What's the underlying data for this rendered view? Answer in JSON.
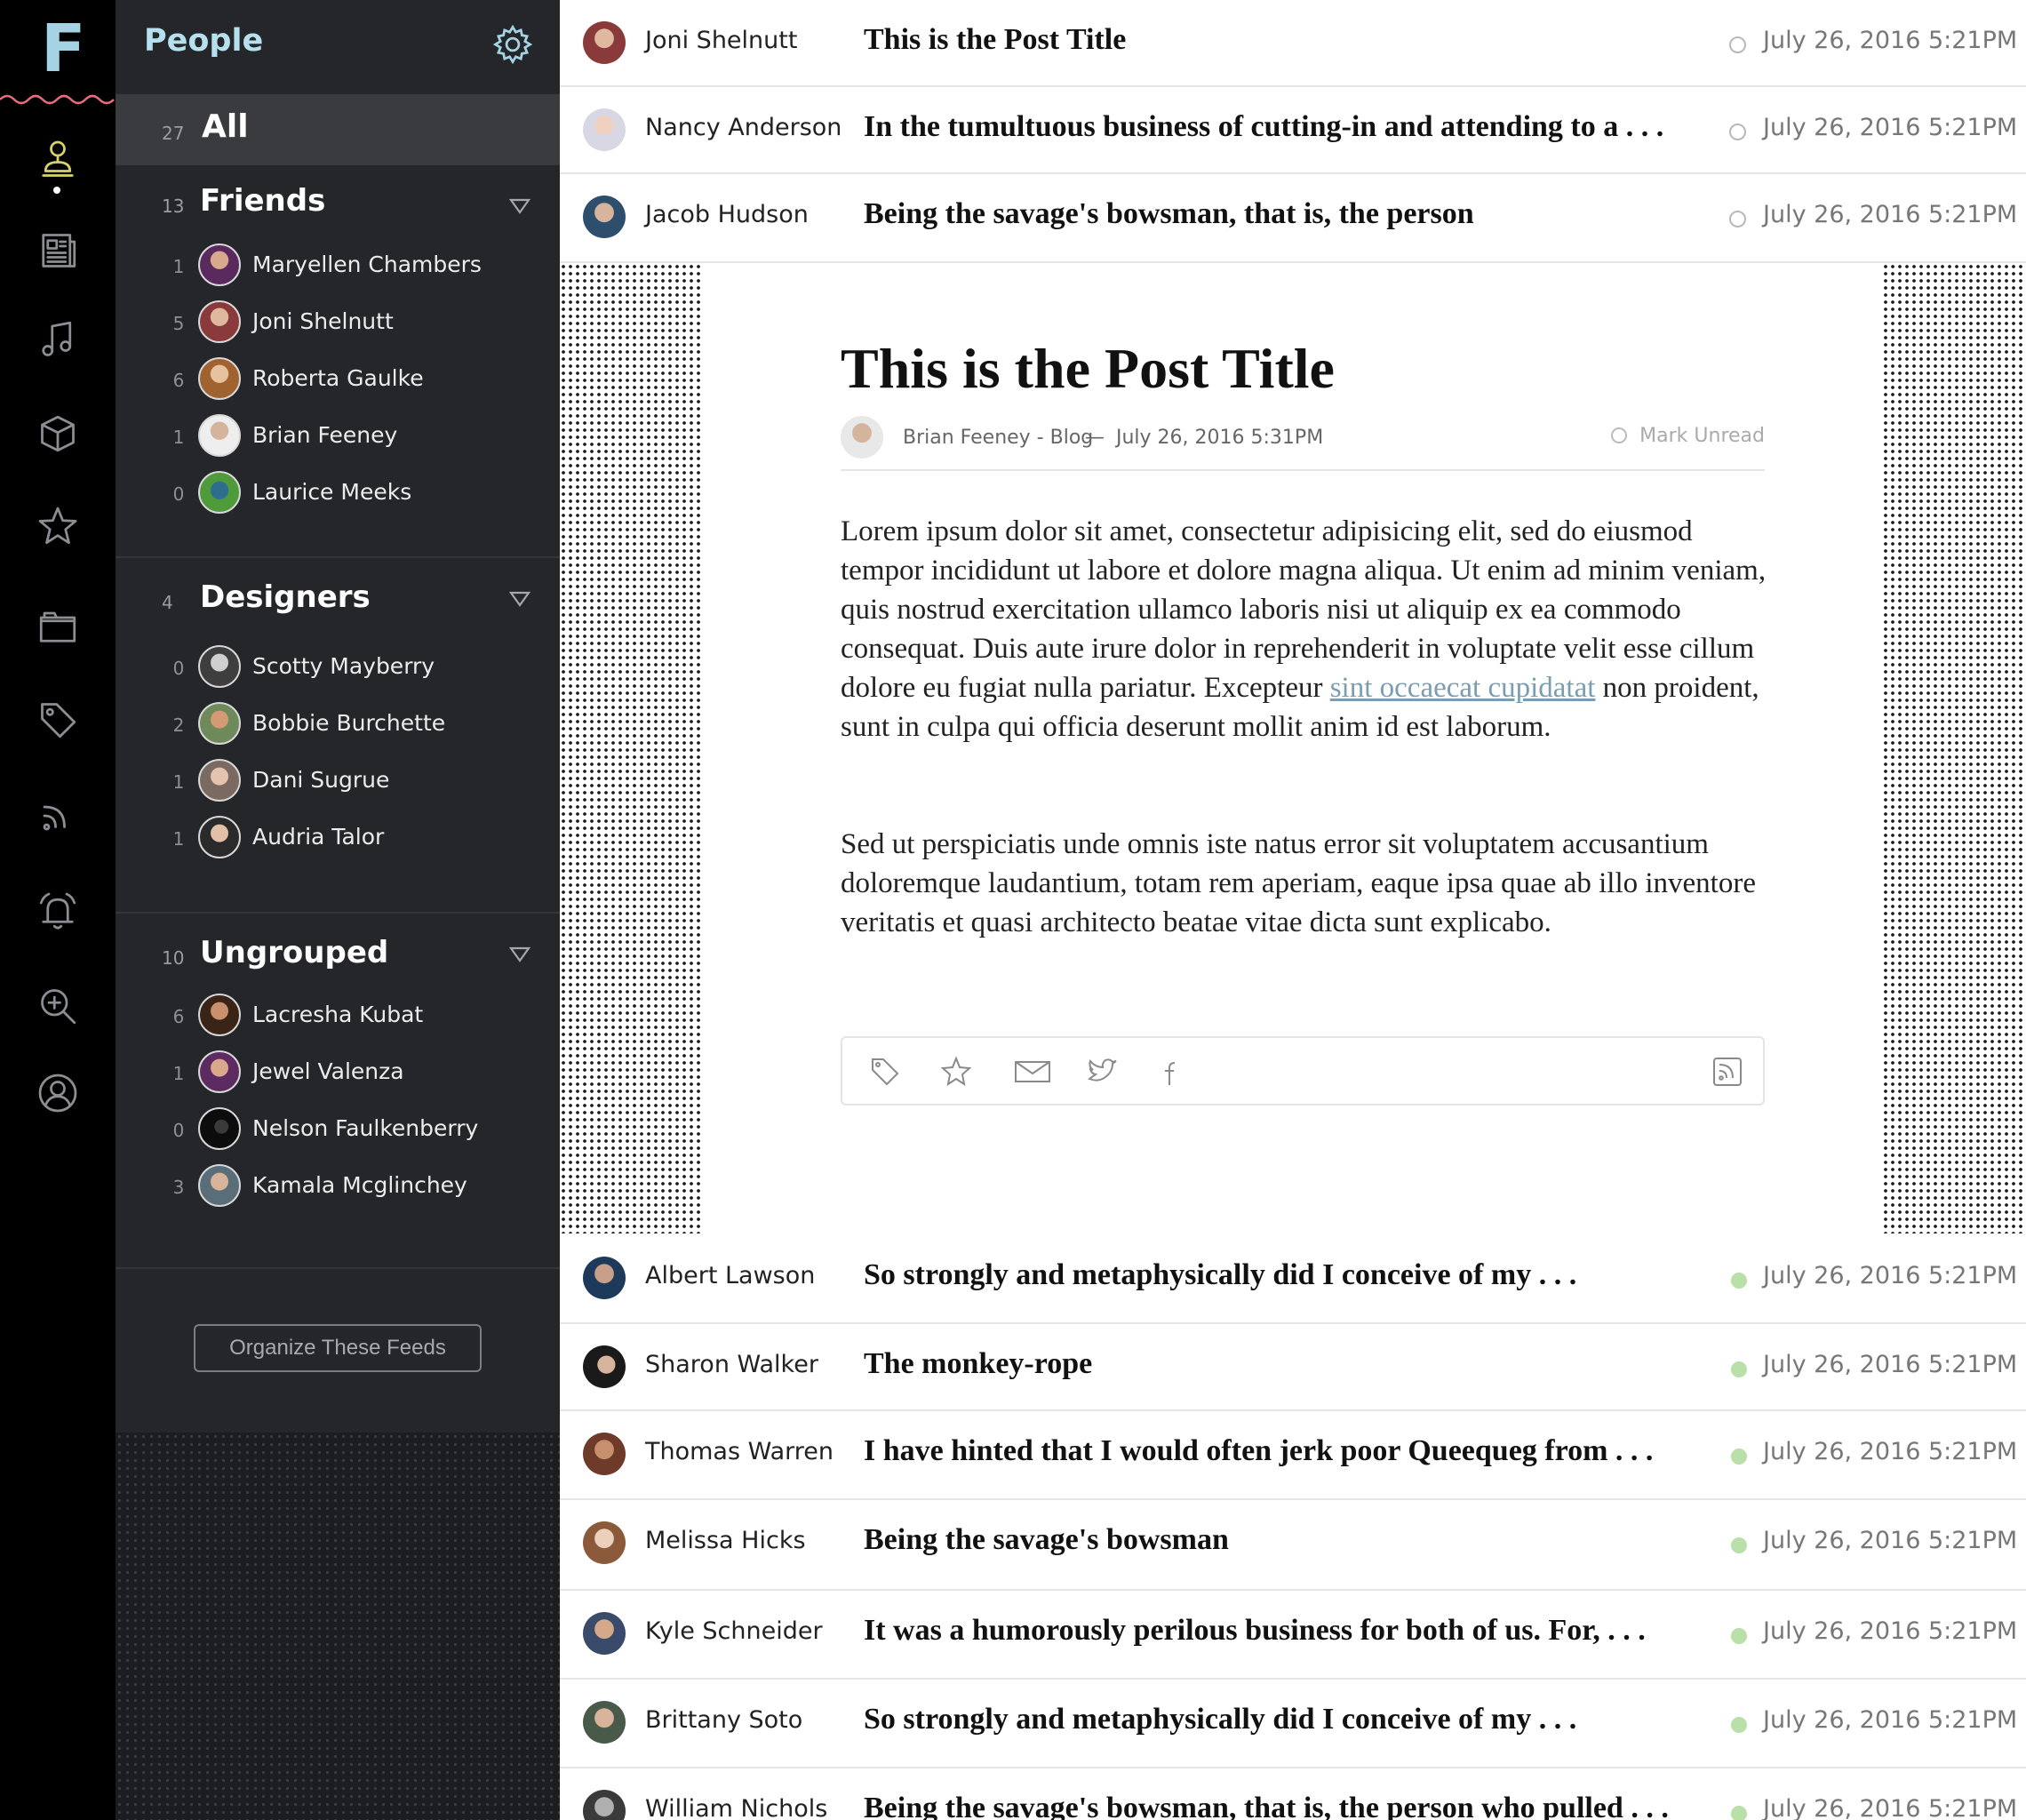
{
  "app": {
    "logo": "F"
  },
  "rail": {
    "icons": [
      "people-icon",
      "newspaper-icon",
      "music-icon",
      "cube-icon",
      "star-icon",
      "folder-icon",
      "tag-icon",
      "rss-icon",
      "alarm-icon",
      "zoom-in-icon",
      "user-circle-icon"
    ],
    "active": "people-icon",
    "accent_color": "#d8d16b",
    "wave_color": "#e46e78"
  },
  "sidebar": {
    "title": "People",
    "all": {
      "count": "27",
      "label": "All"
    },
    "groups": [
      {
        "count": "13",
        "name": "Friends",
        "members": [
          {
            "count": "1",
            "name": "Maryellen Chambers"
          },
          {
            "count": "5",
            "name": "Joni Shelnutt"
          },
          {
            "count": "6",
            "name": "Roberta Gaulke"
          },
          {
            "count": "1",
            "name": "Brian Feeney"
          },
          {
            "count": "0",
            "name": "Laurice Meeks"
          }
        ]
      },
      {
        "count": "4",
        "name": "Designers",
        "members": [
          {
            "count": "0",
            "name": "Scotty Mayberry"
          },
          {
            "count": "2",
            "name": "Bobbie Burchette"
          },
          {
            "count": "1",
            "name": "Dani Sugrue"
          },
          {
            "count": "1",
            "name": "Audria Talor"
          }
        ]
      },
      {
        "count": "10",
        "name": "Ungrouped",
        "members": [
          {
            "count": "6",
            "name": "Lacresha Kubat"
          },
          {
            "count": "1",
            "name": "Jewel Valenza"
          },
          {
            "count": "0",
            "name": "Nelson Faulkenberry"
          },
          {
            "count": "3",
            "name": "Kamala Mcglinchey"
          }
        ]
      }
    ],
    "organize_label": "Organize These Feeds"
  },
  "feed": {
    "top_rows": [
      {
        "author": "Joni Shelnutt",
        "title": "This is the Post Title",
        "date": "July 26, 2016 5:21PM",
        "unread": false
      },
      {
        "author": "Nancy Anderson",
        "title": "In the tumultuous business of cutting-in and attending to a . . .",
        "date": "July 26, 2016 5:21PM",
        "unread": false
      },
      {
        "author": "Jacob Hudson",
        "title": "Being the savage's bowsman, that is, the person",
        "date": "July 26, 2016 5:21PM",
        "unread": false
      }
    ],
    "post": {
      "title": "This is the Post Title",
      "author": "Brian Feeney - Blog",
      "separator": "—",
      "date": "July 26, 2016 5:31PM",
      "mark_unread": "Mark Unread",
      "p1_before": "Lorem ipsum dolor sit amet, consectetur adipisicing elit, sed do eiusmod tempor incididunt ut labore et dolore magna aliqua. Ut enim ad minim veniam, quis nostrud exercitation ullamco laboris nisi ut aliquip ex ea commodo consequat. Duis aute irure dolor in reprehenderit in voluptate velit esse cillum dolore eu fugiat nulla pariatur. Excepteur ",
      "p1_link": "sint occaecat cupidatat",
      "p1_after": " non proident, sunt in culpa qui officia deserunt mollit anim id est laborum.",
      "p2": "Sed ut perspiciatis unde omnis iste natus error sit voluptatem accusantium doloremque laudantium, totam rem aperiam, eaque ipsa quae ab illo inventore veritatis et quasi architecto beatae vitae dicta sunt explicabo.",
      "actions": [
        "tag-icon",
        "star-icon",
        "mail-icon",
        "twitter-icon",
        "facebook-icon",
        "rss-icon"
      ]
    },
    "bottom_rows": [
      {
        "author": "Albert Lawson",
        "title": "So strongly and metaphysically did I conceive of my . . .",
        "date": "July 26, 2016 5:21PM",
        "unread": true
      },
      {
        "author": "Sharon Walker",
        "title": "The monkey-rope",
        "date": "July 26, 2016 5:21PM",
        "unread": true
      },
      {
        "author": "Thomas Warren",
        "title": "I have hinted that I would often jerk poor Queequeg from . . .",
        "date": "July 26, 2016 5:21PM",
        "unread": true
      },
      {
        "author": "Melissa Hicks",
        "title": "Being the savage's bowsman",
        "date": "July 26, 2016 5:21PM",
        "unread": true
      },
      {
        "author": "Kyle Schneider",
        "title": "It was a humorously perilous business for both of us. For,  . . .",
        "date": "July 26, 2016 5:21PM",
        "unread": true
      },
      {
        "author": "Brittany Soto",
        "title": "So strongly and metaphysically did I conceive of my  . . .",
        "date": "July 26, 2016 5:21PM",
        "unread": true
      },
      {
        "author": "William Nichols",
        "title": "Being the savage's bowsman, that is, the person who pulled . . .",
        "date": "July 26, 2016 5:21PM",
        "unread": true
      }
    ],
    "unread_color": "#b8e0a8"
  }
}
